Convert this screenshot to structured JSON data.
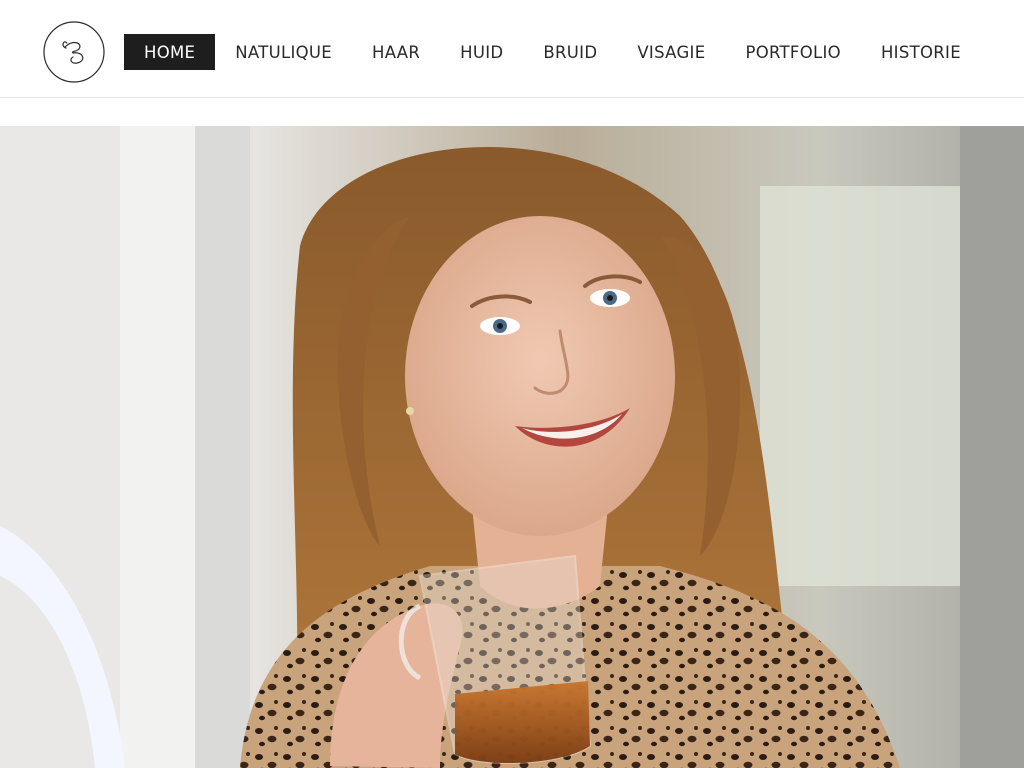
{
  "header": {
    "logo": {
      "name": "brand-monogram",
      "label": "B"
    },
    "nav": [
      {
        "label": "HOME",
        "active": true
      },
      {
        "label": "NATULIQUE",
        "active": false
      },
      {
        "label": "HAAR",
        "active": false
      },
      {
        "label": "HUID",
        "active": false
      },
      {
        "label": "BRUID",
        "active": false
      },
      {
        "label": "VISAGIE",
        "active": false
      },
      {
        "label": "PORTFOLIO",
        "active": false
      },
      {
        "label": "HISTORIE",
        "active": false
      }
    ]
  },
  "hero": {
    "image": "portrait-woman-with-tea-glass"
  },
  "colors": {
    "active_bg": "#1e1e1e",
    "active_text": "#ffffff",
    "nav_text": "#2a2a2a",
    "divider": "#e3e3e3"
  }
}
